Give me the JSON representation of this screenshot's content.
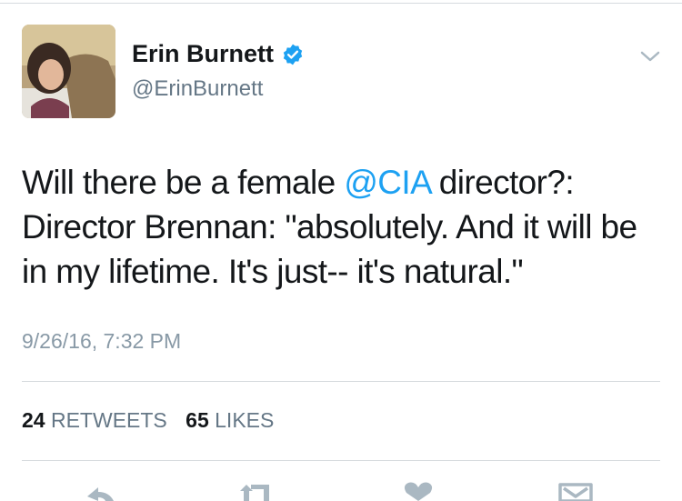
{
  "tweet": {
    "author": {
      "display_name": "Erin Burnett",
      "handle": "@ErinBurnett",
      "verified": true
    },
    "text_before_mention": "Will there be a female ",
    "mention": "@CIA",
    "text_after_mention": " director?: Director Brennan: \"absolutely. And it will be in my lifetime. It's just-- it's natural.\"",
    "timestamp": "9/26/16, 7:32 PM",
    "stats": {
      "retweets_count": "24",
      "retweets_label": "RETWEETS",
      "likes_count": "65",
      "likes_label": "LIKES"
    }
  },
  "colors": {
    "link": "#1da1f2",
    "muted": "#657786",
    "text": "#14171a",
    "action_icons": "#aab8c2"
  },
  "icons": {
    "verified": "verified-badge-icon",
    "menu": "chevron-down-icon",
    "reply": "reply-icon",
    "retweet": "retweet-icon",
    "like": "heart-icon",
    "message": "envelope-icon"
  }
}
